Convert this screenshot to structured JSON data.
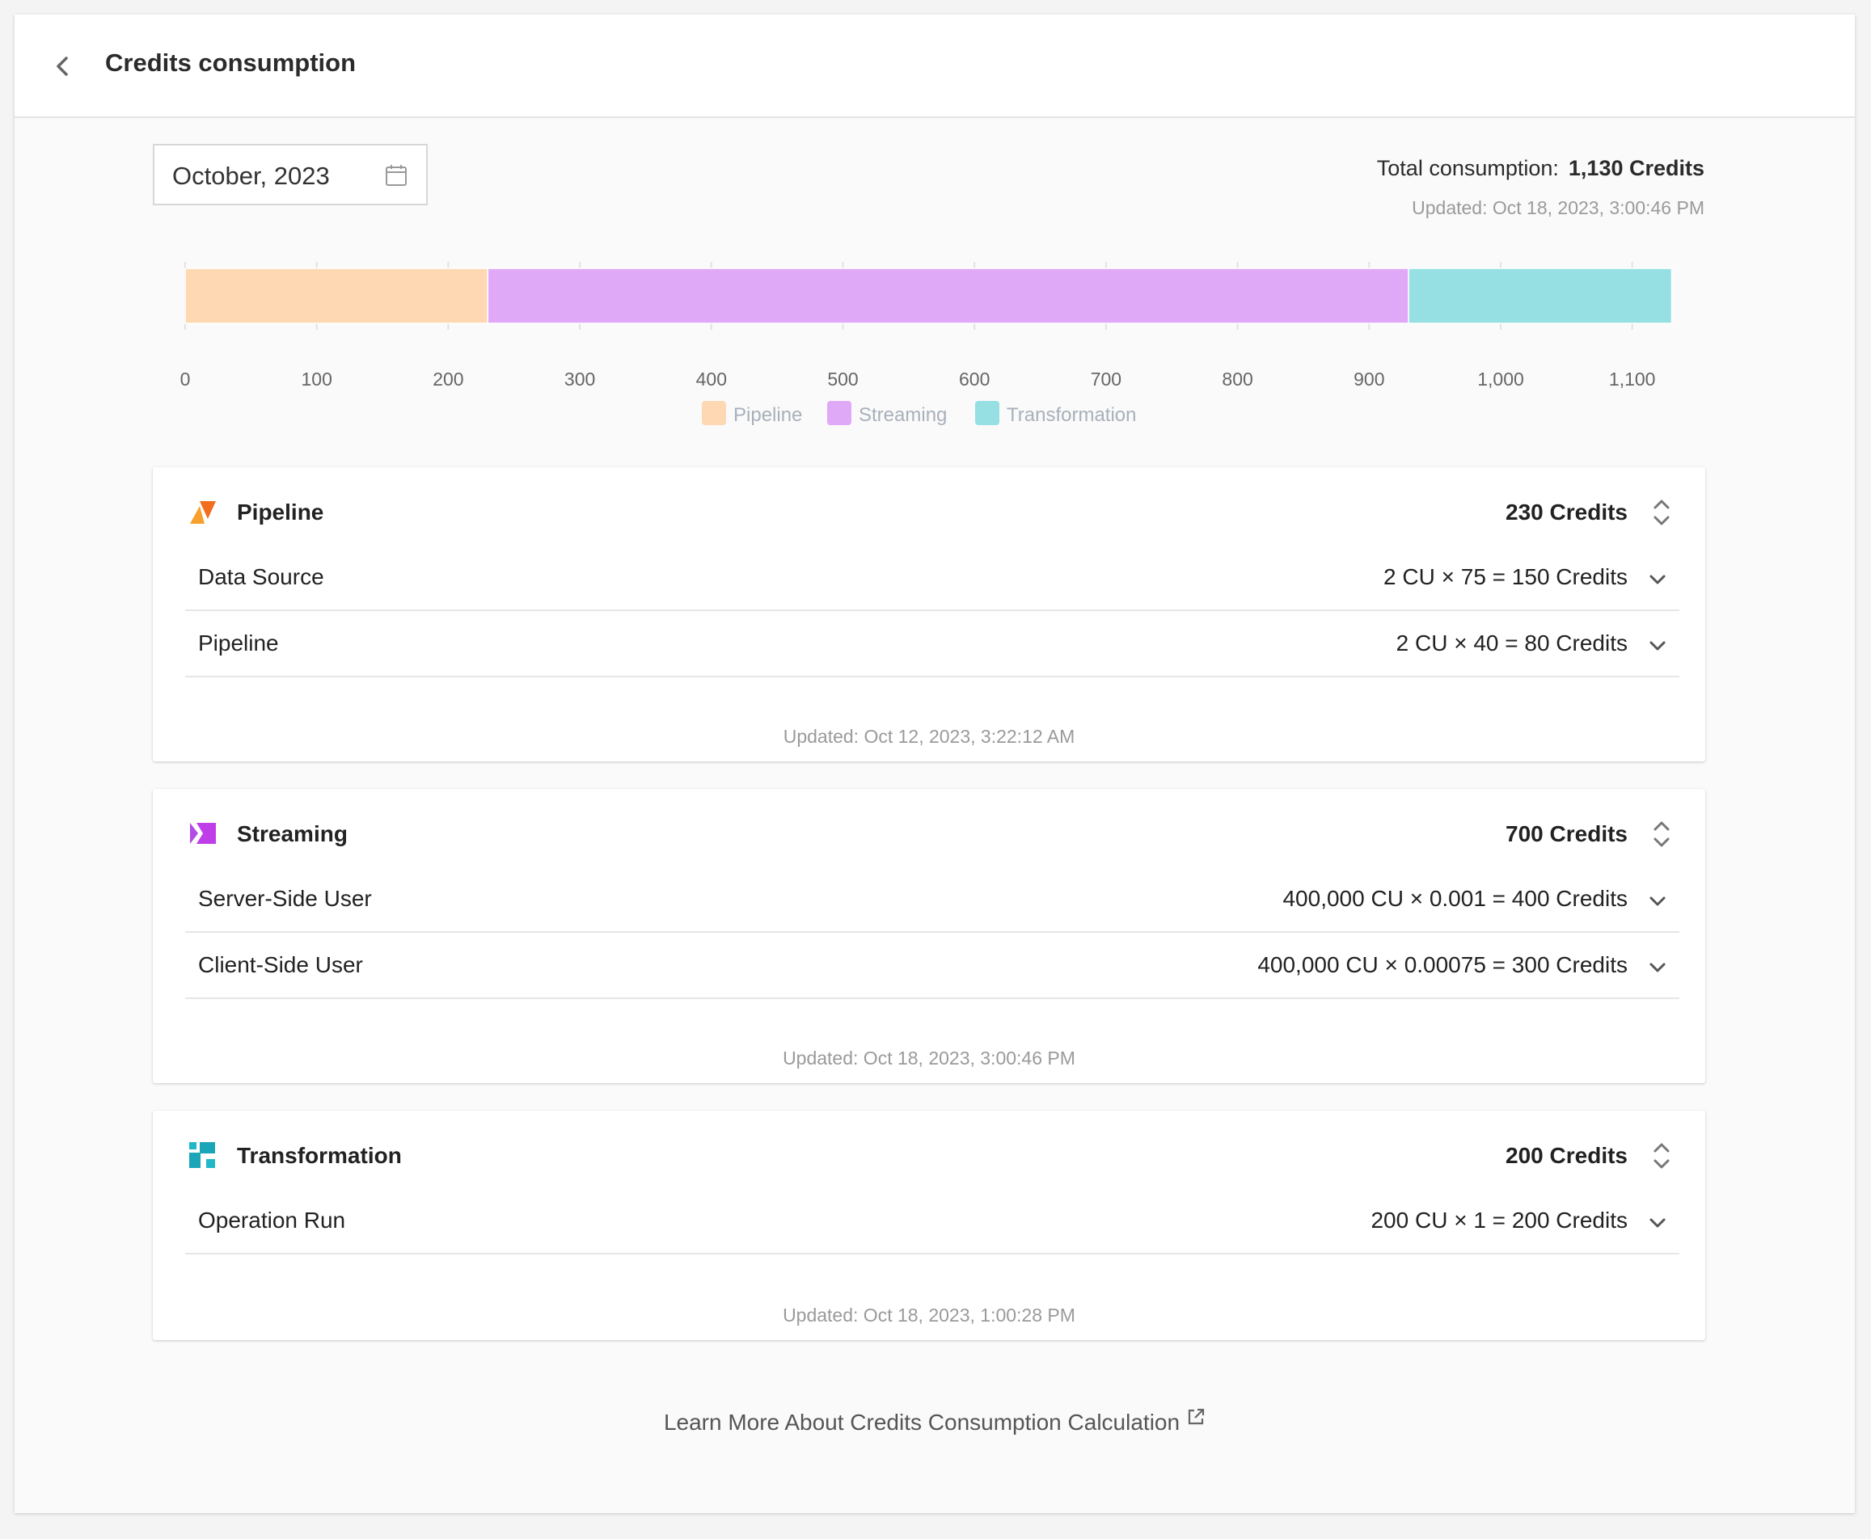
{
  "header": {
    "title": "Credits consumption",
    "back_icon": "chevron-left-icon"
  },
  "date_picker": {
    "value": "October, 2023",
    "icon": "calendar-icon"
  },
  "summary": {
    "total_label": "Total consumption:",
    "total_value": "1,130 Credits",
    "updated": "Updated: Oct 18, 2023, 3:00:46 PM"
  },
  "chart_data": {
    "type": "bar",
    "orientation": "horizontal-stacked",
    "series": [
      {
        "name": "Pipeline",
        "value": 230,
        "color": "#fdd8b3"
      },
      {
        "name": "Streaming",
        "value": 700,
        "color": "#e0a9f7"
      },
      {
        "name": "Transformation",
        "value": 200,
        "color": "#96e0e4"
      }
    ],
    "xlim": [
      0,
      1130
    ],
    "ticks": [
      {
        "value": 0,
        "label": "0"
      },
      {
        "value": 100,
        "label": "100"
      },
      {
        "value": 200,
        "label": "200"
      },
      {
        "value": 300,
        "label": "300"
      },
      {
        "value": 400,
        "label": "400"
      },
      {
        "value": 500,
        "label": "500"
      },
      {
        "value": 600,
        "label": "600"
      },
      {
        "value": 700,
        "label": "700"
      },
      {
        "value": 800,
        "label": "800"
      },
      {
        "value": 900,
        "label": "900"
      },
      {
        "value": 1000,
        "label": "1,000"
      },
      {
        "value": 1100,
        "label": "1,100"
      }
    ],
    "legend_position": "bottom-center",
    "grid": false
  },
  "cards": [
    {
      "title": "Pipeline",
      "icon": "pipeline-icon",
      "total": "230 Credits",
      "rows": [
        {
          "label": "Data Source",
          "value": "2 CU × 75 = 150 Credits"
        },
        {
          "label": "Pipeline",
          "value": "2 CU × 40 = 80 Credits"
        }
      ],
      "updated": "Updated: Oct 12, 2023, 3:22:12 AM"
    },
    {
      "title": "Streaming",
      "icon": "streaming-icon",
      "total": "700 Credits",
      "rows": [
        {
          "label": "Server-Side User",
          "value": "400,000 CU × 0.001 = 400 Credits"
        },
        {
          "label": "Client-Side User",
          "value": "400,000 CU × 0.00075 = 300 Credits"
        }
      ],
      "updated": "Updated: Oct 18, 2023, 3:00:46 PM"
    },
    {
      "title": "Transformation",
      "icon": "transformation-icon",
      "total": "200 Credits",
      "rows": [
        {
          "label": "Operation Run",
          "value": "200 CU × 1 = 200 Credits"
        }
      ],
      "updated": "Updated: Oct 18, 2023, 1:00:28 PM"
    }
  ],
  "footer": {
    "learn_more": "Learn More About Credits Consumption Calculation",
    "icon": "external-link-icon"
  }
}
